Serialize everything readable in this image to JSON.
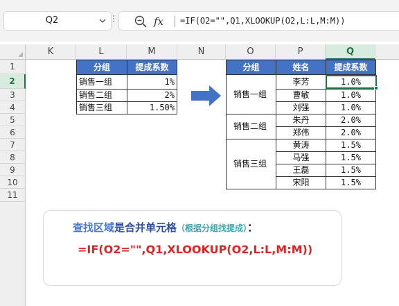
{
  "name_box": {
    "value": "Q2"
  },
  "formula_bar": {
    "zoom_icon": "zoom-out-magnifier-icon",
    "fx_label": "fx",
    "formula": "=IF(O2=\"\",Q1,XLOOKUP(O2,L:L,M:M))"
  },
  "columns": [
    "K",
    "L",
    "M",
    "N",
    "O",
    "P",
    "Q"
  ],
  "rows": [
    "1",
    "2",
    "3",
    "4",
    "5",
    "6",
    "7",
    "8",
    "9",
    "10",
    "11"
  ],
  "lookup_table": {
    "headers": [
      "分组",
      "提成系数"
    ],
    "rows": [
      {
        "group": "销售一组",
        "rate": "1%"
      },
      {
        "group": "销售二组",
        "rate": "2%"
      },
      {
        "group": "销售三组",
        "rate": "1.50%"
      }
    ]
  },
  "result_table": {
    "headers": [
      "分组",
      "姓名",
      "提成系数"
    ],
    "groups": [
      "销售一组",
      "销售二组",
      "销售三组"
    ],
    "names": [
      "李芳",
      "曹敏",
      "刘强",
      "朱丹",
      "郑伟",
      "黄涛",
      "马强",
      "王磊",
      "宋阳"
    ],
    "rates": [
      "1.0%",
      "1.0%",
      "1.0%",
      "2.0%",
      "2.0%",
      "1.5%",
      "1.5%",
      "1.5%",
      "1.5%"
    ]
  },
  "note": {
    "part1": "查找区域",
    "part2": "是合并单元格",
    "part3": "（根据分组找提成）",
    "part4": "：",
    "formula": "=IF(O2=\"\",Q1,XLOOKUP(O2,L:L,M:M))"
  },
  "colors": {
    "header_blue": "#4472c4",
    "selection_green": "#217346",
    "arrow_blue": "#4472c4",
    "formula_red": "#e02424"
  }
}
